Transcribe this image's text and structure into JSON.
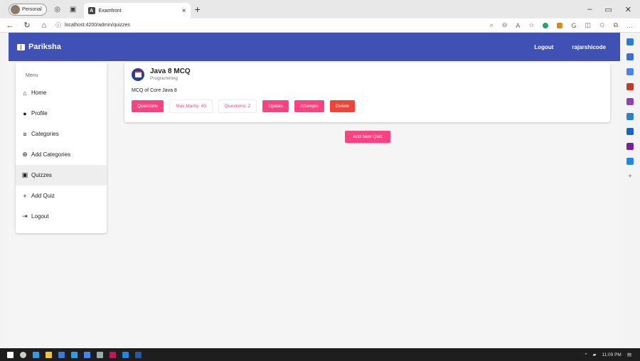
{
  "browser": {
    "profile_label": "Personal",
    "tab_title": "Examfront",
    "url": "localhost:4200/admin/quizzes",
    "win_controls": [
      "–",
      "▭",
      "✕"
    ]
  },
  "app": {
    "brand": "Pariksha",
    "logout_label": "Logout",
    "username": "rajarshicode"
  },
  "sidebar": {
    "heading": "Menu",
    "items": [
      {
        "label": "Home",
        "icon": "home-icon",
        "glyph": "⌂"
      },
      {
        "label": "Profile",
        "icon": "profile-icon",
        "glyph": "●"
      },
      {
        "label": "Categories",
        "icon": "list-icon",
        "glyph": "≡"
      },
      {
        "label": "Add Categories",
        "icon": "add-circle-icon",
        "glyph": "⊕"
      },
      {
        "label": "Quizzes",
        "icon": "quiz-icon",
        "glyph": "▣"
      },
      {
        "label": "Add Quiz",
        "icon": "plus-icon",
        "glyph": "+"
      },
      {
        "label": "Logout",
        "icon": "logout-icon",
        "glyph": "⇥"
      }
    ]
  },
  "quiz": {
    "title": "Java 8 MCQ",
    "category": "Programming",
    "description": "MCQ of Core Java 8",
    "questions_btn": "Questions",
    "max_marks": "Max Marks: 40",
    "question_count": "Questions: 2",
    "update_btn": "Update",
    "attempts_btn": "Attempts",
    "delete_btn": "Delete"
  },
  "add_quiz_btn": "Add New Quiz",
  "taskbar": {
    "time": "11:09 PM"
  },
  "colors": {
    "primary": "#3f51b5",
    "accent": "#ff4081",
    "warn": "#f44336"
  }
}
